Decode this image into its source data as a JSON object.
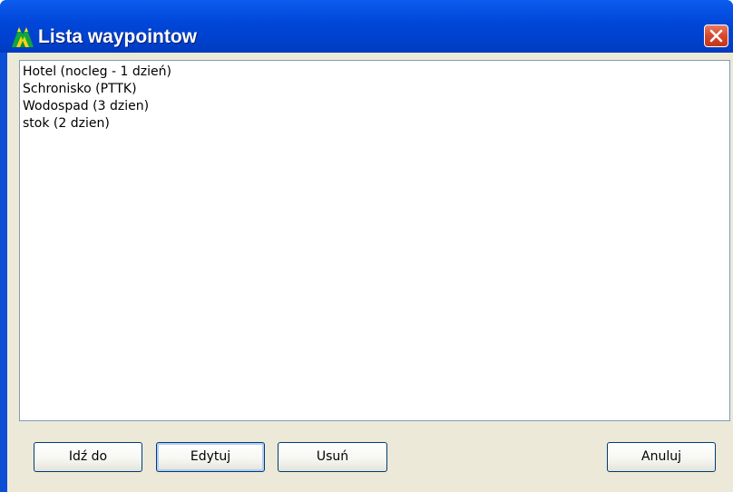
{
  "window": {
    "title": "Lista waypointow"
  },
  "waypoints": [
    "Hotel (nocleg - 1 dzień)",
    "Schronisko (PTTK)",
    "Wodospad (3 dzien)",
    "stok (2 dzien)"
  ],
  "buttons": {
    "goto": "Idź do",
    "edit": "Edytuj",
    "delete": "Usuń",
    "cancel": "Anuluj"
  },
  "icons": {
    "app": "mountain-app-icon",
    "close": "close-icon"
  },
  "colors": {
    "titlebar": "#0046d8",
    "close_button": "#d7482e",
    "dialog_background": "#ece9d8",
    "list_border": "#7f9db9"
  }
}
